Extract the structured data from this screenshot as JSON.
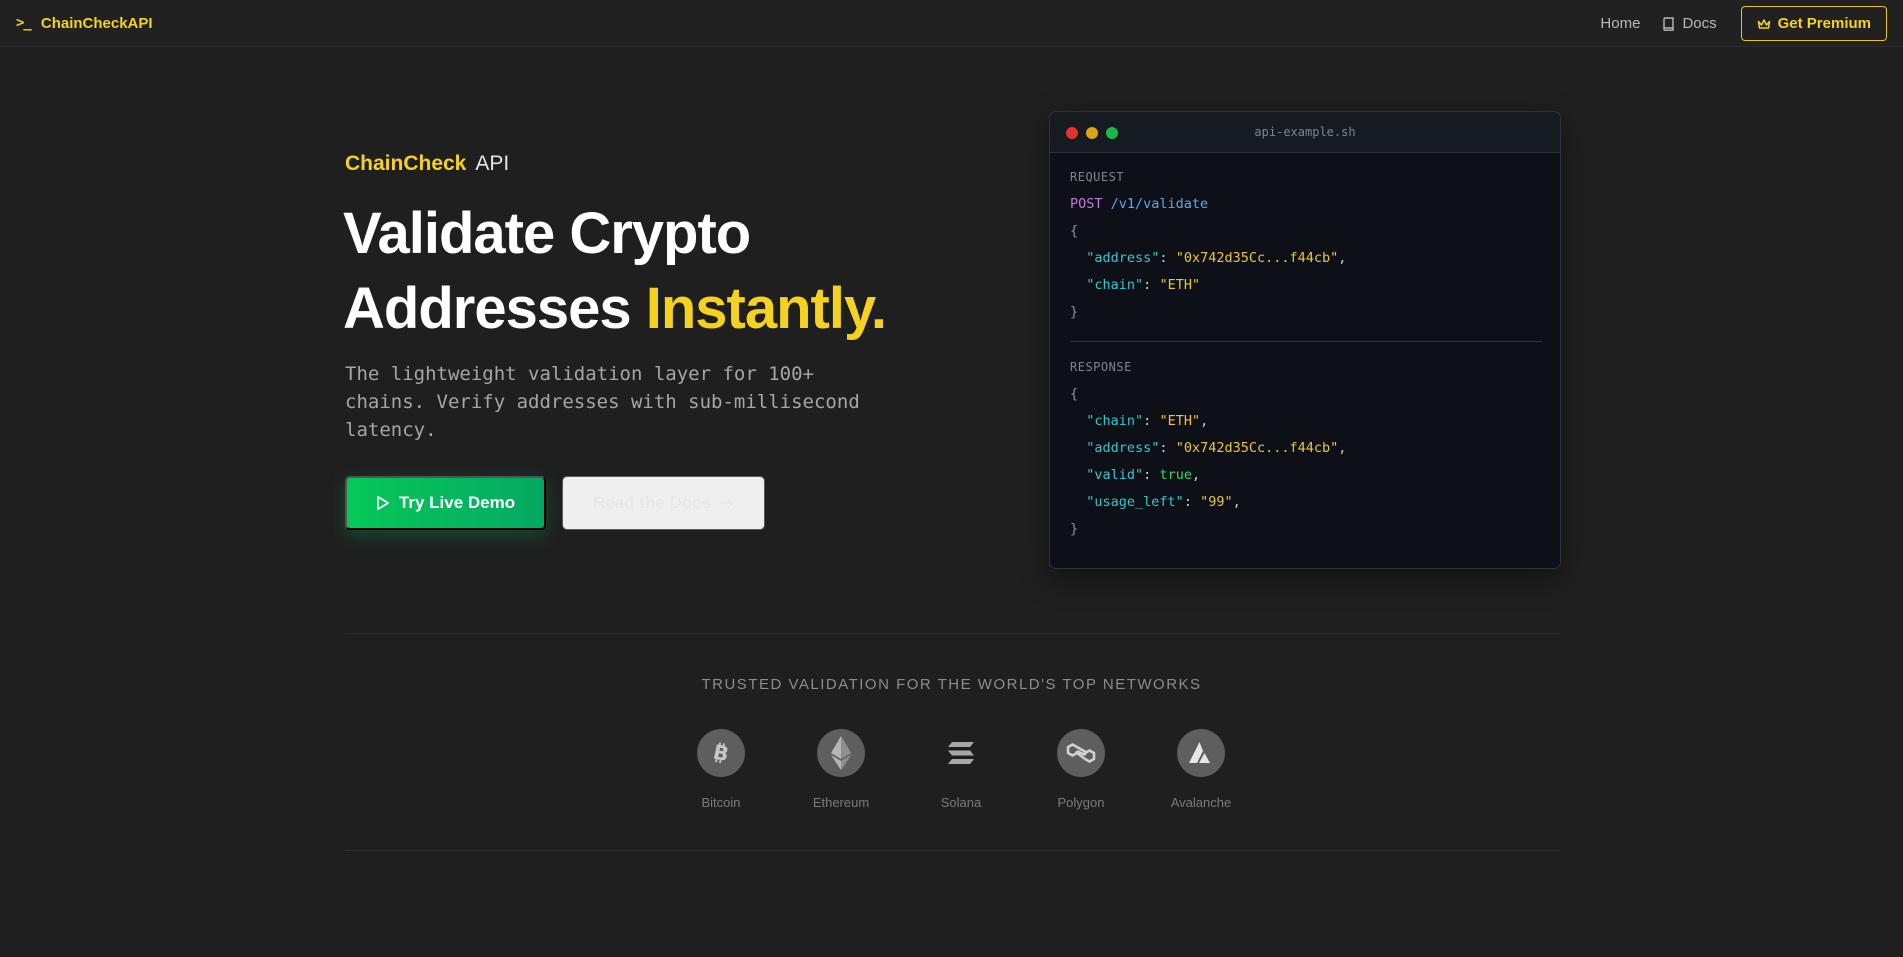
{
  "nav": {
    "brand_glyph": ">_",
    "brand": "ChainCheckAPI",
    "home": "Home",
    "docs": "Docs",
    "premium": "Get Premium"
  },
  "hero": {
    "eyebrow_bold": "ChainCheck",
    "eyebrow_rest": "API",
    "headline_line1": "Validate Crypto",
    "headline_line2_plain": "Addresses ",
    "headline_line2_highlight": "Instantly.",
    "subtitle": "The lightweight validation layer for 100+ chains. Verify addresses with sub-millisecond latency.",
    "demo_button": "Try Live Demo",
    "docs_button": "Read the Docs"
  },
  "code_window": {
    "filename": "api-example.sh",
    "request_label": "REQUEST",
    "method": "POST",
    "path": "/v1/validate",
    "request": {
      "address_key": "\"address\"",
      "address_val": "\"0x742d35Cc...f44cb\"",
      "chain_key": "\"chain\"",
      "chain_val": "\"ETH\""
    },
    "response_label": "RESPONSE",
    "response": {
      "chain_key": "\"chain\"",
      "chain_val": "\"ETH\"",
      "address_key": "\"address\"",
      "address_val": "\"0x742d35Cc...f44cb\"",
      "valid_key": "\"valid\"",
      "valid_val": "true",
      "usage_key": "\"usage_left\"",
      "usage_val": "\"99\""
    }
  },
  "trusted": {
    "heading": "TRUSTED VALIDATION FOR THE WORLD'S TOP NETWORKS",
    "networks": [
      {
        "name": "Bitcoin",
        "icon": "bitcoin-icon"
      },
      {
        "name": "Ethereum",
        "icon": "ethereum-icon"
      },
      {
        "name": "Solana",
        "icon": "solana-icon"
      },
      {
        "name": "Polygon",
        "icon": "polygon-icon"
      },
      {
        "name": "Avalanche",
        "icon": "avalanche-icon"
      }
    ]
  },
  "colors": {
    "accent": "#f5d21f",
    "primary_green": "#05c957",
    "background": "#1f1f1f",
    "code_bg": "#0d1117"
  }
}
